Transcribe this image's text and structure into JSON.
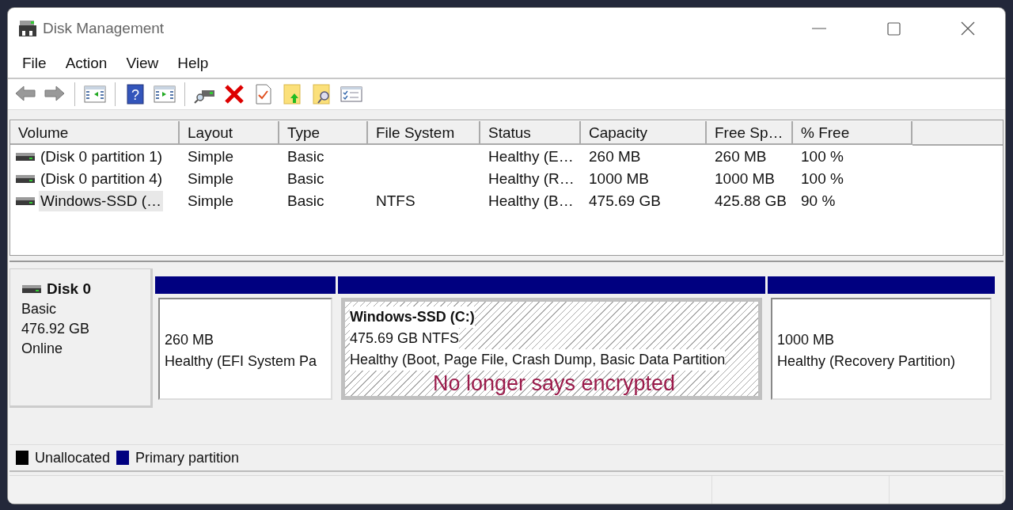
{
  "window": {
    "title": "Disk Management"
  },
  "menu": [
    "File",
    "Action",
    "View",
    "Help"
  ],
  "toolbar": {
    "help_glyph": "?"
  },
  "volume_table": {
    "columns": [
      "Volume",
      "Layout",
      "Type",
      "File System",
      "Status",
      "Capacity",
      "Free Sp…",
      "% Free"
    ],
    "rows": [
      {
        "volume": "(Disk 0 partition 1)",
        "layout": "Simple",
        "type": "Basic",
        "status": "Healthy (E…",
        "capacity": "260 MB",
        "free_space": "260 MB",
        "percent_free": "100 %",
        "selected": false
      },
      {
        "volume": "(Disk 0 partition 4)",
        "layout": "Simple",
        "type": "Basic",
        "status": "Healthy (R…",
        "capacity": "1000 MB",
        "free_space": "1000 MB",
        "percent_free": "100 %",
        "selected": false
      },
      {
        "volume": "Windows-SSD (…",
        "layout": "Simple",
        "type": "Basic",
        "file_system": "NTFS",
        "status": "Healthy (B…",
        "capacity": "475.69 GB",
        "free_space": "425.88 GB",
        "percent_free": "90 %",
        "selected": true
      }
    ]
  },
  "disk": {
    "name": "Disk 0",
    "type": "Basic",
    "size": "476.92 GB",
    "status": "Online",
    "partitions": [
      {
        "color": "#000080",
        "lines": [
          "260 MB",
          "Healthy (EFI System Pa"
        ],
        "selected": false
      },
      {
        "color": "#000080",
        "title": "Windows-SSD  (C:)",
        "lines": [
          "475.69 GB NTFS",
          "Healthy (Boot, Page File, Crash Dump, Basic Data Partition"
        ],
        "annotation": "No longer says encrypted",
        "selected": true
      },
      {
        "color": "#000080",
        "lines": [
          "1000 MB",
          "Healthy (Recovery Partition)"
        ],
        "selected": false
      }
    ]
  },
  "legend": [
    {
      "label": "Unallocated",
      "color": "#000000"
    },
    {
      "label": "Primary partition",
      "color": "#000080"
    }
  ]
}
